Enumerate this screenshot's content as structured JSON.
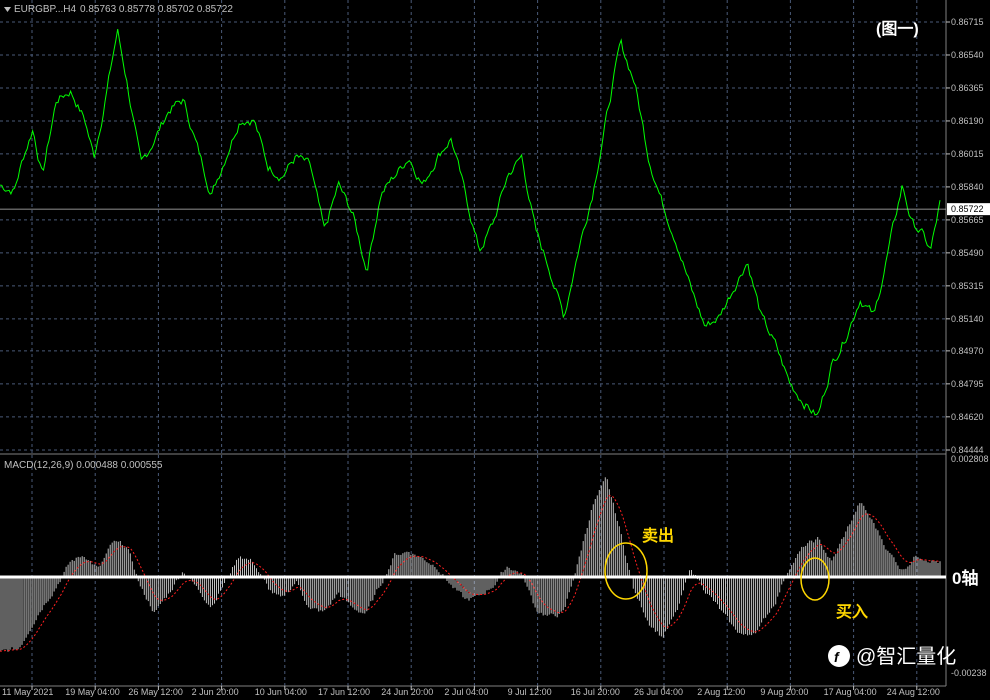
{
  "chart_header": {
    "symbol_label": "EURGBP...H4",
    "ohlc": "0.85763 0.85778 0.85702 0.85722"
  },
  "figure_tag": "(图一)",
  "macd_header": "MACD(12,26,9) 0.000488 0.000555",
  "annotations": {
    "sell": "卖出",
    "buy": "买入",
    "zero_axis": "0轴"
  },
  "watermark": {
    "text": "@智汇量化",
    "icon": "logo-f-icon"
  },
  "colors": {
    "price_line": "#00ff00",
    "histogram": "#c0c0c0",
    "signal_line": "#ff2020",
    "annotation": "#ffd700",
    "grid": "#4a5a78",
    "axis": "#c0c0c0"
  },
  "chart_data": [
    {
      "type": "line",
      "name": "EURGBP H4 price",
      "ylim": [
        0.84444,
        0.86715
      ],
      "y_ticks": [
        "0.86715",
        "0.86540",
        "0.86365",
        "0.86190",
        "0.86015",
        "0.85840",
        "0.85665",
        "0.85490",
        "0.85315",
        "0.85140",
        "0.84970",
        "0.84795",
        "0.84620",
        "0.84444"
      ],
      "current_price": "0.85722",
      "x_labels": [
        "11 May 2021",
        "19 May 04:00",
        "26 May 12:00",
        "2 Jun 20:00",
        "10 Jun 04:00",
        "17 Jun 12:00",
        "24 Jun 20:00",
        "2 Jul 04:00",
        "9 Jul 12:00",
        "16 Jul 20:00",
        "26 Jul 04:00",
        "2 Aug 12:00",
        "9 Aug 20:00",
        "17 Aug 04:00",
        "24 Aug 12:00"
      ],
      "keypoints": [
        [
          0,
          0.8585
        ],
        [
          0.015,
          0.8582
        ],
        [
          0.025,
          0.86
        ],
        [
          0.035,
          0.8615
        ],
        [
          0.045,
          0.859
        ],
        [
          0.06,
          0.863
        ],
        [
          0.075,
          0.8635
        ],
        [
          0.09,
          0.862
        ],
        [
          0.1,
          0.86
        ],
        [
          0.11,
          0.8625
        ],
        [
          0.125,
          0.8667
        ],
        [
          0.135,
          0.864
        ],
        [
          0.15,
          0.8595
        ],
        [
          0.165,
          0.861
        ],
        [
          0.18,
          0.8625
        ],
        [
          0.195,
          0.863
        ],
        [
          0.21,
          0.8605
        ],
        [
          0.225,
          0.858
        ],
        [
          0.24,
          0.86
        ],
        [
          0.255,
          0.862
        ],
        [
          0.27,
          0.862
        ],
        [
          0.285,
          0.8595
        ],
        [
          0.3,
          0.859
        ],
        [
          0.315,
          0.86
        ],
        [
          0.33,
          0.8595
        ],
        [
          0.345,
          0.856
        ],
        [
          0.36,
          0.8585
        ],
        [
          0.375,
          0.857
        ],
        [
          0.39,
          0.854
        ],
        [
          0.405,
          0.858
        ],
        [
          0.42,
          0.859
        ],
        [
          0.435,
          0.86
        ],
        [
          0.45,
          0.8585
        ],
        [
          0.465,
          0.86
        ],
        [
          0.48,
          0.861
        ],
        [
          0.495,
          0.858
        ],
        [
          0.51,
          0.855
        ],
        [
          0.525,
          0.8565
        ],
        [
          0.54,
          0.859
        ],
        [
          0.555,
          0.86
        ],
        [
          0.57,
          0.856
        ],
        [
          0.585,
          0.854
        ],
        [
          0.6,
          0.8515
        ],
        [
          0.615,
          0.855
        ],
        [
          0.63,
          0.858
        ],
        [
          0.645,
          0.862
        ],
        [
          0.66,
          0.866
        ],
        [
          0.675,
          0.864
        ],
        [
          0.69,
          0.86
        ],
        [
          0.705,
          0.8575
        ],
        [
          0.72,
          0.8555
        ],
        [
          0.735,
          0.853
        ],
        [
          0.75,
          0.851
        ],
        [
          0.765,
          0.8515
        ],
        [
          0.78,
          0.853
        ],
        [
          0.795,
          0.8545
        ],
        [
          0.81,
          0.8515
        ],
        [
          0.825,
          0.85
        ],
        [
          0.84,
          0.848
        ],
        [
          0.855,
          0.847
        ],
        [
          0.87,
          0.8462
        ],
        [
          0.885,
          0.849
        ],
        [
          0.9,
          0.8505
        ],
        [
          0.915,
          0.8525
        ],
        [
          0.93,
          0.8515
        ],
        [
          0.945,
          0.855
        ],
        [
          0.96,
          0.8585
        ],
        [
          0.97,
          0.8565
        ],
        [
          0.98,
          0.856
        ],
        [
          0.99,
          0.855
        ],
        [
          1,
          0.8575
        ]
      ]
    },
    {
      "type": "bar",
      "name": "MACD(12,26,9)",
      "ylim": [
        -0.00238,
        0.002808
      ],
      "y_ticks": [
        "0.002808",
        "-0.00238"
      ],
      "zero_label": "0轴",
      "histogram_keypoints": [
        [
          0,
          -0.0019
        ],
        [
          0.02,
          -0.0018
        ],
        [
          0.04,
          -0.0009
        ],
        [
          0.06,
          -0.0002
        ],
        [
          0.075,
          0.0004
        ],
        [
          0.09,
          0.0006
        ],
        [
          0.105,
          0.0002
        ],
        [
          0.12,
          0.0009
        ],
        [
          0.135,
          0.0008
        ],
        [
          0.15,
          -0.0003
        ],
        [
          0.165,
          -0.0009
        ],
        [
          0.18,
          -0.0004
        ],
        [
          0.195,
          0.0002
        ],
        [
          0.21,
          -0.0003
        ],
        [
          0.225,
          -0.0007
        ],
        [
          0.24,
          -0.0001
        ],
        [
          0.255,
          0.0006
        ],
        [
          0.27,
          0.0004
        ],
        [
          0.285,
          -0.0003
        ],
        [
          0.3,
          -0.0006
        ],
        [
          0.315,
          -0.0001
        ],
        [
          0.33,
          -0.0008
        ],
        [
          0.345,
          -0.0009
        ],
        [
          0.36,
          -0.0004
        ],
        [
          0.375,
          -0.0008
        ],
        [
          0.39,
          -0.0009
        ],
        [
          0.405,
          -0.0002
        ],
        [
          0.42,
          0.0006
        ],
        [
          0.435,
          0.0007
        ],
        [
          0.45,
          0.0005
        ],
        [
          0.465,
          0.0003
        ],
        [
          0.48,
          -0.0002
        ],
        [
          0.495,
          -0.0006
        ],
        [
          0.51,
          -0.0005
        ],
        [
          0.525,
          -0.0002
        ],
        [
          0.54,
          0.0003
        ],
        [
          0.555,
          0.0001
        ],
        [
          0.57,
          -0.0008
        ],
        [
          0.585,
          -0.001
        ],
        [
          0.6,
          -0.0009
        ],
        [
          0.615,
          0.0004
        ],
        [
          0.63,
          0.0019
        ],
        [
          0.645,
          0.0026
        ],
        [
          0.66,
          0.0012
        ],
        [
          0.675,
          -0.0004
        ],
        [
          0.69,
          -0.0011
        ],
        [
          0.705,
          -0.0015
        ],
        [
          0.72,
          -0.0009
        ],
        [
          0.735,
          0.0002
        ],
        [
          0.75,
          -0.0003
        ],
        [
          0.765,
          -0.0008
        ],
        [
          0.78,
          -0.0013
        ],
        [
          0.795,
          -0.0015
        ],
        [
          0.81,
          -0.0012
        ],
        [
          0.825,
          -0.0006
        ],
        [
          0.84,
          0.0003
        ],
        [
          0.855,
          0.0008
        ],
        [
          0.87,
          0.001
        ],
        [
          0.885,
          0.0004
        ],
        [
          0.9,
          0.0012
        ],
        [
          0.915,
          0.002
        ],
        [
          0.93,
          0.0014
        ],
        [
          0.945,
          0.0007
        ],
        [
          0.96,
          0.0002
        ],
        [
          0.975,
          0.0006
        ],
        [
          0.99,
          0.0005
        ],
        [
          1,
          0.0004
        ]
      ]
    }
  ]
}
